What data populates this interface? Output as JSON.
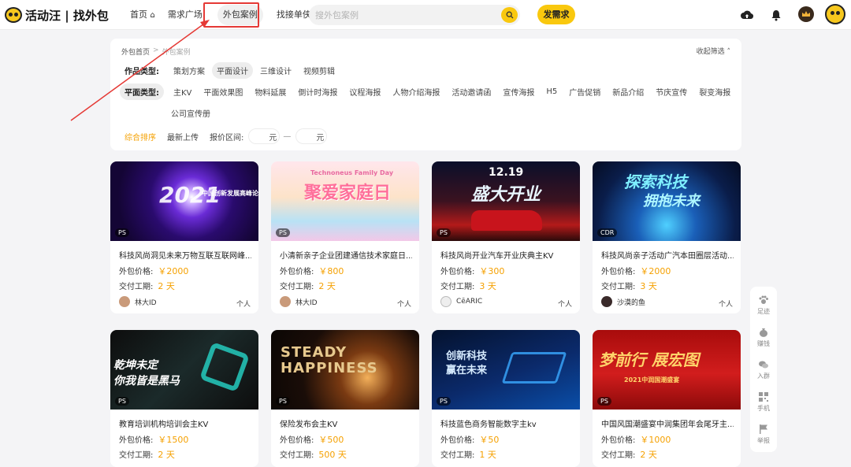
{
  "header": {
    "logo_text": "活动汪 | 找外包",
    "nav": [
      "首页",
      "需求广场",
      "外包案例",
      "找接单侠"
    ],
    "active_nav": "外包案例",
    "search_placeholder": "搜外包案例",
    "post_button": "发需求"
  },
  "breadcrumb": {
    "home": "外包首页",
    "separator": ">",
    "current": "外包案例"
  },
  "collapse_label": "收起筛选",
  "filters": {
    "category_label": "作品类型:",
    "categories": [
      "策划方案",
      "平面设计",
      "三维设计",
      "视频剪辑"
    ],
    "active_category": "平面设计",
    "subtype_label": "平面类型:",
    "subtypes": [
      "主KV",
      "平面效果图",
      "物料延展",
      "倒计时海报",
      "议程海报",
      "人物介绍海报",
      "活动邀请函",
      "宣传海报",
      "H5",
      "广告促销",
      "新品介绍",
      "节庆宣传",
      "裂变海报",
      "公司宣传册"
    ]
  },
  "sort": {
    "options": [
      "综合排序",
      "最新上传"
    ],
    "active": "综合排序",
    "price_label": "报价区间:",
    "unit": "元",
    "dash": "—"
  },
  "labels": {
    "price": "外包价格:",
    "period": "交付工期:"
  },
  "cards": [
    {
      "title": "科技风尚洞见未来万物互联互联网峰...",
      "price": "￥2000",
      "period": "2 天",
      "author": "林大ID",
      "type": "个人",
      "badge": "PS",
      "img_text": "2021",
      "img_sub": "中国创新发展高峰论"
    },
    {
      "title": "小清新亲子企业团建通信技术家庭日...",
      "price": "￥800",
      "period": "2 天",
      "author": "林大ID",
      "type": "个人",
      "badge": "PS",
      "img_text": "聚爱家庭日",
      "img_sub": "Technoneus Family Day"
    },
    {
      "title": "科技风尚开业汽车开业庆典主KV",
      "price": "￥300",
      "period": "3 天",
      "author": "CēARIC",
      "type": "个人",
      "badge": "PS",
      "img_text": "盛大开业",
      "img_sub": "12.19"
    },
    {
      "title": "科技风尚亲子活动广汽本田圈层活动...",
      "price": "￥2000",
      "period": "3 天",
      "author": "沙漠的鱼",
      "type": "个人",
      "badge": "CDR",
      "img_text": "探索科技",
      "img_sub": "拥抱未来"
    },
    {
      "title": "教育培训机构培训会主KV",
      "price": "￥1500",
      "period": "2 天",
      "author": "",
      "type": "",
      "badge": "PS",
      "img_text": "乾坤未定",
      "img_sub": "你我皆是黑马"
    },
    {
      "title": "保险发布会主KV",
      "price": "￥500",
      "period": "500 天",
      "author": "",
      "type": "",
      "badge": "PS",
      "img_text": "STEADY",
      "img_sub": "HAPPINESS"
    },
    {
      "title": "科技蓝色商务智能数字主kv",
      "price": "￥50",
      "period": "1 天",
      "author": "",
      "type": "",
      "badge": "PS",
      "img_text": "创新科技",
      "img_sub": "赢在未来"
    },
    {
      "title": "中国风国潮盛宴中润集团年会尾牙主...",
      "price": "￥1000",
      "period": "2 天",
      "author": "",
      "type": "",
      "badge": "PS",
      "img_text": "梦前行 展宏图",
      "img_sub": "2021中润国潮盛宴"
    }
  ],
  "float_bar": [
    "足迹",
    "赚钱",
    "入群",
    "手机",
    "举报"
  ],
  "colors": {
    "accent": "#f9c80e",
    "price": "#f5a000",
    "annotation": "#e53935"
  }
}
